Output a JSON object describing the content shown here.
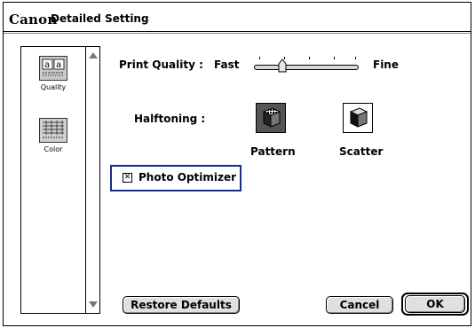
{
  "window": {
    "brand": "Canon",
    "title": "Detailed Setting"
  },
  "sidebar": {
    "items": [
      {
        "label": "Quality",
        "icon": "quality-icon"
      },
      {
        "label": "Color",
        "icon": "color-icon"
      }
    ]
  },
  "print_quality": {
    "label": "Print Quality :",
    "min_label": "Fast",
    "max_label": "Fine"
  },
  "halftoning": {
    "label": "Halftoning :",
    "options": [
      {
        "label": "Pattern",
        "icon": "pattern-icon"
      },
      {
        "label": "Scatter",
        "icon": "scatter-icon"
      }
    ]
  },
  "photo_optimizer": {
    "label": "Photo Optimizer",
    "checked": true,
    "mark": "✕"
  },
  "buttons": {
    "restore": "Restore Defaults",
    "cancel": "Cancel",
    "ok": "OK"
  }
}
